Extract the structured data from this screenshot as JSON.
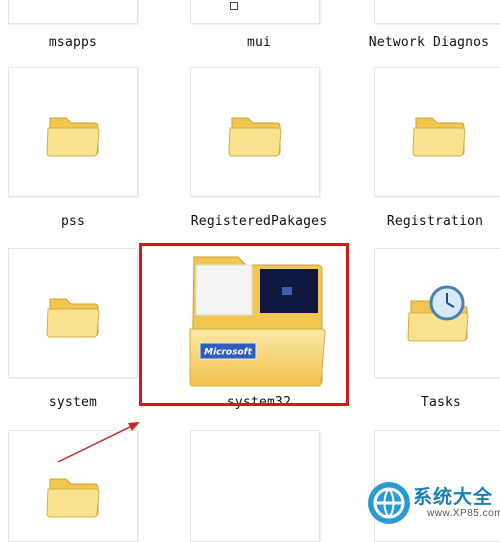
{
  "folders_top_row": [
    "msapps",
    "mui",
    "Network Diagnos"
  ],
  "folders_row2": [
    "pss",
    "RegisteredPakages",
    "Registration"
  ],
  "folders_row3": [
    "system",
    "system32",
    "Tasks"
  ],
  "selected_folder": {
    "name": "system32",
    "thumb_brand": "Microsoft"
  },
  "watermark": {
    "title": "系统大全",
    "url": "www.XP85.com"
  },
  "colors": {
    "highlight_box": "#d9161b",
    "arrow": "#c62828",
    "folder": "#f6d36a",
    "watermark_blue": "#1a7fb5"
  }
}
